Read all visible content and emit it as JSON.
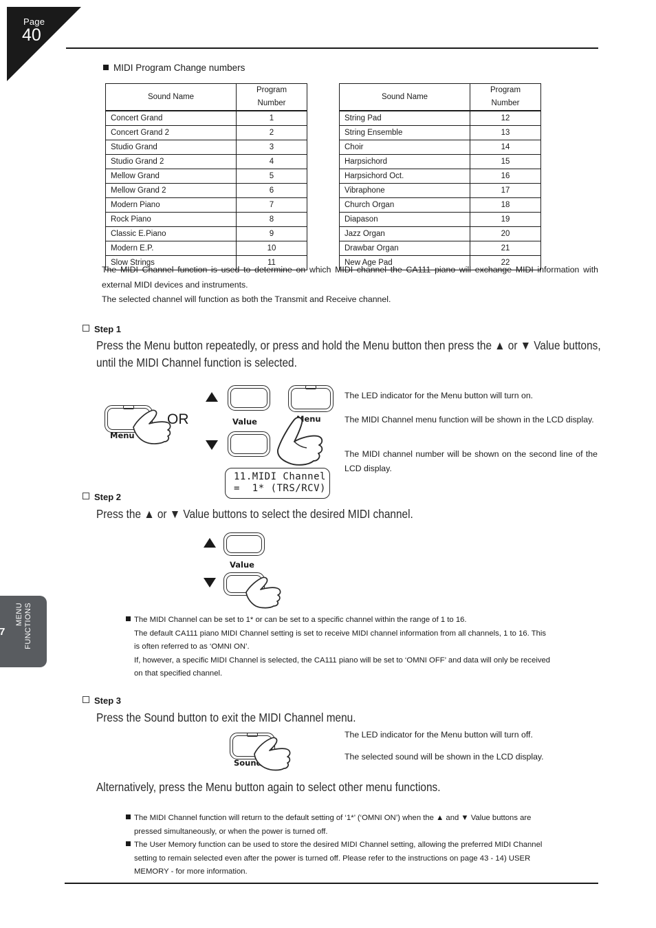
{
  "page": {
    "label": "Page",
    "number": "40",
    "side_tab_number": "7",
    "side_tab_text": "MENU\nFUNCTIONS"
  },
  "section": {
    "heading": "MIDI Program Change numbers"
  },
  "tables": {
    "headers": [
      "Sound Name",
      "Program Number"
    ],
    "left_rows": [
      [
        "Concert Grand",
        "1"
      ],
      [
        "Concert Grand 2",
        "2"
      ],
      [
        "Studio Grand",
        "3"
      ],
      [
        "Studio Grand 2",
        "4"
      ],
      [
        "Mellow Grand",
        "5"
      ],
      [
        "Mellow Grand 2",
        "6"
      ],
      [
        "Modern Piano",
        "7"
      ],
      [
        "Rock Piano",
        "8"
      ],
      [
        "Classic E.Piano",
        "9"
      ],
      [
        "Modern E.P.",
        "10"
      ],
      [
        "Slow Strings",
        "11"
      ]
    ],
    "right_rows": [
      [
        "String Pad",
        "12"
      ],
      [
        "String Ensemble",
        "13"
      ],
      [
        "Choir",
        "14"
      ],
      [
        "Harpsichord",
        "15"
      ],
      [
        "Harpsichord Oct.",
        "16"
      ],
      [
        "Vibraphone",
        "17"
      ],
      [
        "Church Organ",
        "18"
      ],
      [
        "Diapason",
        "19"
      ],
      [
        "Jazz Organ",
        "20"
      ],
      [
        "Drawbar Organ",
        "21"
      ],
      [
        "New Age Pad",
        "22"
      ]
    ]
  },
  "intro": {
    "p1": "The MIDI Channel function is used to determine on which MIDI channel the CA111 piano will exchange MIDI information with external MIDI devices and instruments.",
    "p2": "The selected channel will function as both the Transmit and Receive channel."
  },
  "step1": {
    "label": "Step 1",
    "instruction": "Press the Menu button repeatedly, or press and hold the Menu button then press the ▲ or ▼ Value buttons,\nuntil the MIDI Channel function is selected.",
    "or_text": "OR",
    "menu_button_label": "Menu",
    "value_button_label": "Value",
    "menu_button_label_2": "Menu",
    "lcd_line1": "11.MIDI Channel",
    "lcd_line2": "=  1* (TRS/RCV)",
    "note1": "The LED indicator for the Menu button will turn on.",
    "note2": "The MIDI Channel menu function will be shown in the LCD display.",
    "note3": "The MIDI channel number will be shown on the second line of the LCD display."
  },
  "step2": {
    "label": "Step 2",
    "instruction": "Press the ▲ or ▼ Value buttons to select the desired MIDI channel.",
    "value_button_label": "Value",
    "notes": [
      "The MIDI Channel can be set to 1* or can be set to a specific channel within the range of 1 to 16.",
      "The default CA111 piano MIDI Channel setting is set to receive MIDI channel information from all channels, 1 to 16.  This",
      "is often referred to as ‘OMNI ON’.",
      "If, however, a specific MIDI Channel is selected, the CA111 piano will be set to ‘OMNI OFF’ and data will only be received",
      "on that specified channel."
    ]
  },
  "step3": {
    "label": "Step 3",
    "instruction": "Press the Sound button to exit the MIDI Channel menu.",
    "sound_button_label": "Sound",
    "note1": "The LED indicator for the Menu button will turn off.",
    "note2": "The selected sound will be shown in the LCD display.",
    "alternatively": "Alternatively, press the Menu button again to select other menu functions.",
    "notes": [
      "The MIDI Channel function will return to the default setting of ‘1*’ (‘OMNI ON’) when the ▲ and ▼ Value buttons are",
      "pressed simultaneously, or when the power is turned off.",
      "The User Memory function can be used to store the desired MIDI Channel setting, allowing the preferred MIDI Channel",
      "setting to remain selected even after the power is turned off.  Please refer to the instructions on page 43 - 14) USER",
      "MEMORY - for more information."
    ]
  },
  "colors": {
    "ink": "#1a1a1a",
    "tab_gray": "#595c60"
  }
}
